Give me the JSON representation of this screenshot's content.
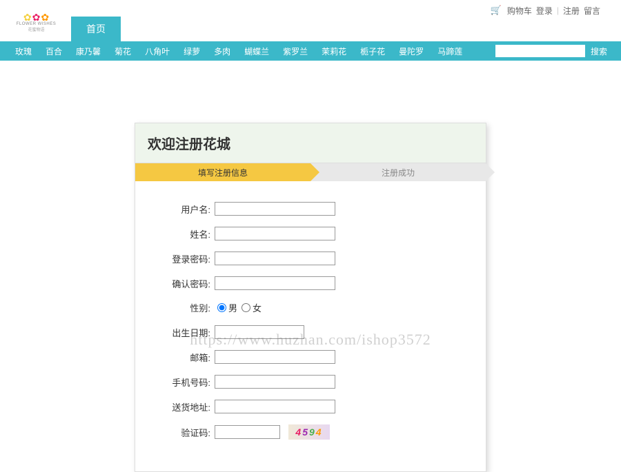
{
  "topnav": {
    "cart": "购物车",
    "login": "登录",
    "register": "注册",
    "message": "留言"
  },
  "logo": {
    "text": "FLOWER WISHES",
    "sub": "花蜜物语"
  },
  "homeBtn": "首页",
  "categories": [
    "玫瑰",
    "百合",
    "康乃馨",
    "菊花",
    "八角叶",
    "绿萝",
    "多肉",
    "蝴蝶兰",
    "紫罗兰",
    "茉莉花",
    "栀子花",
    "曼陀罗",
    "马蹄莲"
  ],
  "searchBtn": "搜索",
  "panel": {
    "title": "欢迎注册花城",
    "step1": "填写注册信息",
    "step2": "注册成功"
  },
  "form": {
    "username": "用户名:",
    "name": "姓名:",
    "password": "登录密码:",
    "confirm": "确认密码:",
    "gender": "性别:",
    "male": "男",
    "female": "女",
    "birthday": "出生日期:",
    "email": "邮箱:",
    "phone": "手机号码:",
    "address": "送货地址:",
    "captcha": "验证码:",
    "captchaValue": "4594"
  },
  "watermark": "https://www.huzhan.com/ishop3572"
}
